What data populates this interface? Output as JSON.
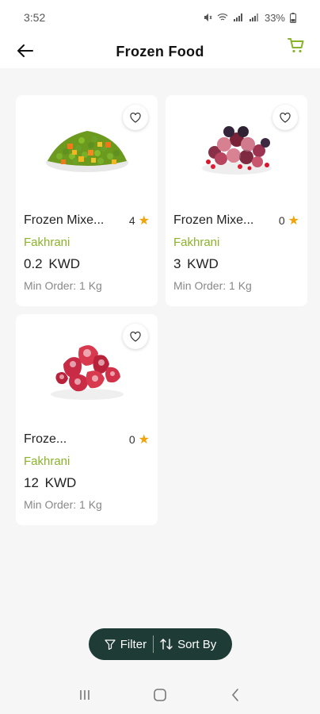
{
  "status_bar": {
    "time": "3:52",
    "battery": "33%",
    "icons": [
      "mute-icon",
      "wifi-icon",
      "signal-icon",
      "signal-icon",
      "battery-icon"
    ]
  },
  "header": {
    "title": "Frozen Food",
    "back_icon": "arrow-left-icon",
    "cart_icon": "cart-icon",
    "accent_color": "#8ab32a"
  },
  "products": [
    {
      "name": "Frozen Mixe...",
      "rating": "4",
      "brand": "Fakhrani",
      "price": "0.2  KWD",
      "min_order": "Min Order: 1 Kg",
      "image": "mixed-vegetables"
    },
    {
      "name": "Frozen Mixe...",
      "rating": "0",
      "brand": "Fakhrani",
      "price": "3  KWD",
      "min_order": "Min Order: 1 Kg",
      "image": "mixed-berries"
    },
    {
      "name": "Froze...",
      "rating": "0",
      "brand": "Fakhrani",
      "price": "12  KWD",
      "min_order": "Min Order: 1 Kg",
      "image": "strawberries"
    }
  ],
  "bottom_actions": {
    "filter_label": "Filter",
    "sort_label": "Sort By",
    "background": "#1f3b36"
  },
  "colors": {
    "brand_green": "#8ab32a",
    "star": "#f0a30a",
    "page_bg": "#f6f6f6"
  }
}
